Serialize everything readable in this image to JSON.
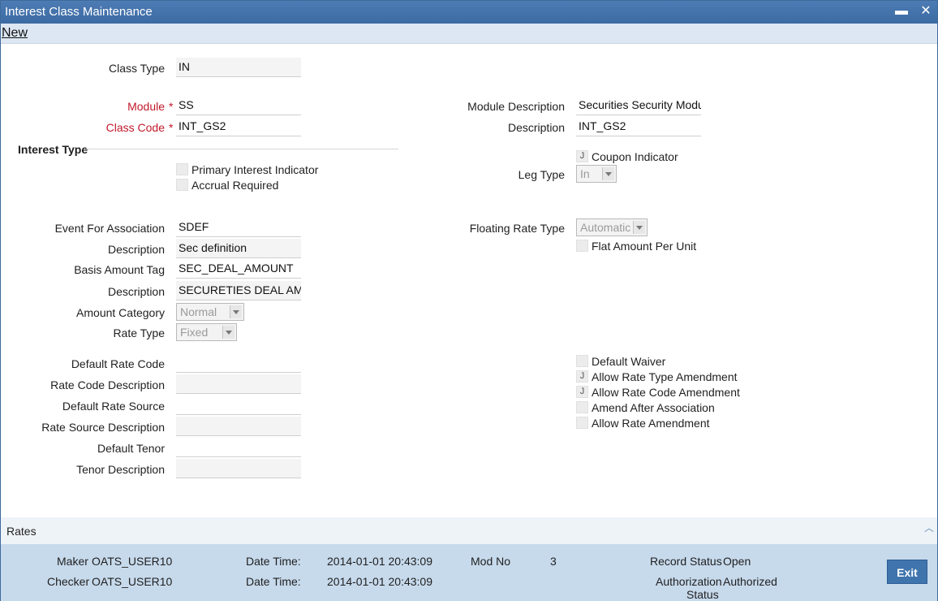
{
  "window": {
    "title": "Interest Class Maintenance"
  },
  "menu": {
    "new_label": "New"
  },
  "form": {
    "class_type": {
      "label": "Class Type",
      "value": "IN"
    },
    "module": {
      "label": "Module",
      "value": "SS"
    },
    "class_code": {
      "label": "Class Code",
      "value": "INT_GS2"
    },
    "module_description": {
      "label": "Module Description",
      "value": "Securities Security Modul"
    },
    "description": {
      "label": "Description",
      "value": "INT_GS2"
    },
    "required_mark": "*",
    "interest_type": {
      "title": "Interest Type",
      "primary_interest_indicator": "Primary Interest Indicator",
      "accrual_required": "Accrual Required"
    },
    "coupon_indicator": "Coupon Indicator",
    "leg_type": {
      "label": "Leg Type",
      "value": "In"
    },
    "event_for_association": {
      "label": "Event For Association",
      "value": "SDEF"
    },
    "event_description": {
      "label": "Description",
      "value": "Sec definition"
    },
    "basis_amount_tag": {
      "label": "Basis Amount Tag",
      "value": "SEC_DEAL_AMOUNT"
    },
    "basis_description": {
      "label": "Description",
      "value": "SECURETIES DEAL AMC"
    },
    "amount_category": {
      "label": "Amount Category",
      "value": "Normal"
    },
    "rate_type": {
      "label": "Rate Type",
      "value": "Fixed"
    },
    "floating_rate_type": {
      "label": "Floating Rate Type",
      "value": "Automatic"
    },
    "flat_amount_per_unit": "Flat Amount Per Unit",
    "default_rate_code": {
      "label": "Default Rate Code",
      "value": ""
    },
    "rate_code_description": {
      "label": "Rate Code Description",
      "value": ""
    },
    "default_rate_source": {
      "label": "Default Rate Source",
      "value": ""
    },
    "rate_source_description": {
      "label": "Rate Source Description",
      "value": ""
    },
    "default_tenor": {
      "label": "Default Tenor",
      "value": ""
    },
    "tenor_description": {
      "label": "Tenor Description",
      "value": ""
    },
    "checks": {
      "default_waiver": "Default Waiver",
      "allow_rate_type_amendment": "Allow Rate Type Amendment",
      "allow_rate_code_amendment": "Allow Rate Code Amendment",
      "amend_after_association": "Amend After Association",
      "allow_rate_amendment": "Allow Rate Amendment"
    },
    "check_mark": "J"
  },
  "rates": {
    "label": "Rates"
  },
  "footer": {
    "maker_label": "Maker",
    "maker": "OATS_USER10",
    "checker_label": "Checker",
    "checker": "OATS_USER10",
    "date_time_label": "Date Time:",
    "maker_date": "2014-01-01 20:43:09",
    "checker_date": "2014-01-01 20:43:09",
    "mod_no_label": "Mod No",
    "mod_no": "3",
    "record_status_label": "Record Status",
    "record_status": "Open",
    "authorization_label": "Authorization",
    "authorization_label_2": "Status",
    "authorization_status": "Authorized",
    "exit_label": "Exit"
  }
}
